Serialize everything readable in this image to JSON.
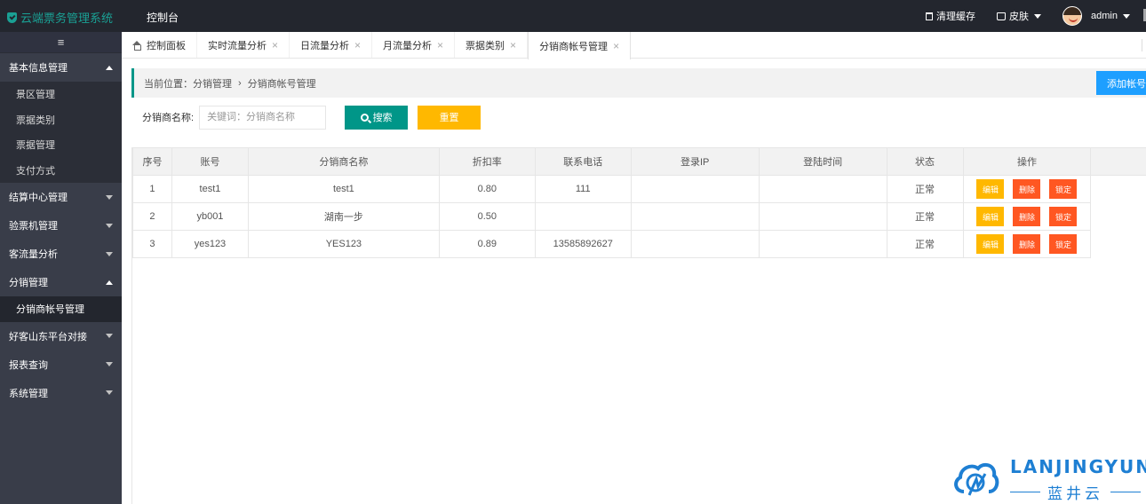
{
  "header": {
    "app_title": "云端票务管理系统",
    "console": "控制台",
    "clear_cache": "清理缓存",
    "skin": "皮肤",
    "username": "admin"
  },
  "sidebar": {
    "toggle_icon": "hamburger-icon",
    "groups": [
      {
        "label": "基本信息管理",
        "open": true,
        "items": [
          "景区管理",
          "票据类别",
          "票据管理",
          "支付方式"
        ]
      },
      {
        "label": "结算中心管理",
        "open": false
      },
      {
        "label": "验票机管理",
        "open": false
      },
      {
        "label": "客流量分析",
        "open": false
      },
      {
        "label": "分销管理",
        "open": true,
        "items": [
          "分销商帐号管理"
        ]
      },
      {
        "label": "好客山东平台对接",
        "open": false
      },
      {
        "label": "报表查询",
        "open": false
      },
      {
        "label": "系统管理",
        "open": false
      }
    ]
  },
  "tabs": [
    {
      "label": "控制面板",
      "closable": false
    },
    {
      "label": "实时流量分析",
      "closable": true
    },
    {
      "label": "日流量分析",
      "closable": true
    },
    {
      "label": "月流量分析",
      "closable": true
    },
    {
      "label": "票据类别",
      "closable": true
    },
    {
      "label": "分销商帐号管理",
      "closable": true,
      "active": true
    }
  ],
  "breadcrumb": {
    "prefix": "当前位置：",
    "parent": "分销管理",
    "separator": "›",
    "current": "分销商帐号管理"
  },
  "add_button": "添加帐号",
  "search": {
    "label": "分销商名称:",
    "placeholder": "关键词：分销商名称",
    "value": "",
    "search_button": "搜索",
    "reset_button": "重置"
  },
  "table": {
    "headers": [
      "序号",
      "账号",
      "分销商名称",
      "折扣率",
      "联系电话",
      "登录IP",
      "登陆时间",
      "状态",
      "操作"
    ],
    "rows": [
      {
        "no": "1",
        "account": "test1",
        "name": "test1",
        "discount": "0.80",
        "phone": "111",
        "ip": "",
        "login_time": "",
        "status": "正常"
      },
      {
        "no": "2",
        "account": "yb001",
        "name": "湖南一步",
        "discount": "0.50",
        "phone": "",
        "ip": "",
        "login_time": "",
        "status": "正常"
      },
      {
        "no": "3",
        "account": "yes123",
        "name": "YES123",
        "discount": "0.89",
        "phone": "13585892627",
        "ip": "",
        "login_time": "",
        "status": "正常"
      }
    ],
    "actions": {
      "edit": "编辑",
      "delete": "删除",
      "lock": "锁定"
    }
  },
  "watermark": {
    "brand": "LANJINGYUN",
    "sub": "蓝井云"
  },
  "colors": {
    "topbar": "#23262e",
    "sidebar": "#393d49",
    "accent": "#009688",
    "warning": "#ffb800",
    "danger": "#ff5722",
    "primary": "#1e9fff"
  }
}
